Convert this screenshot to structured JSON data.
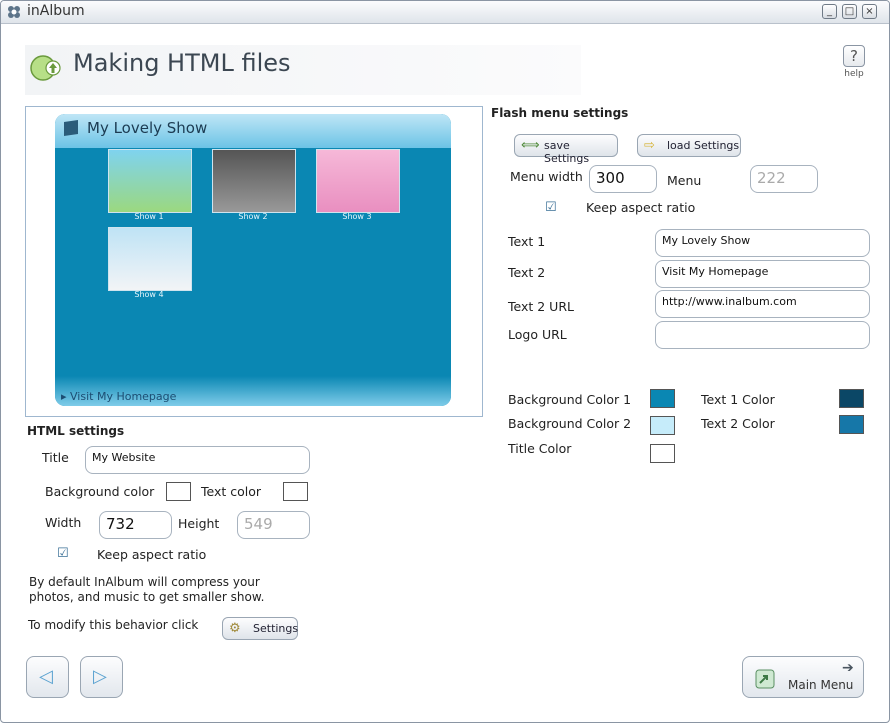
{
  "window": {
    "title": "inAlbum",
    "controls": [
      "_",
      "□",
      "×"
    ]
  },
  "header": {
    "title": "Making HTML files",
    "help_label": "help",
    "help_glyph": "?"
  },
  "preview": {
    "show_title": "My Lovely Show",
    "link_text": "▸ Visit My Homepage",
    "thumbs": [
      {
        "label": "Show 1"
      },
      {
        "label": "Show 2"
      },
      {
        "label": "Show 3"
      },
      {
        "label": "Show 4"
      }
    ]
  },
  "html_settings": {
    "heading": "HTML settings",
    "title_label": "Title",
    "title_value": "My Website",
    "bg_color_label": "Background color",
    "text_color_label": "Text color",
    "width_label": "Width",
    "width_value": "732",
    "height_label": "Height",
    "height_value": "549",
    "aspect_label": "Keep aspect ratio",
    "note_line1": "By default InAlbum will compress your",
    "note_line2": "photos, and music to get smaller show.",
    "modify_label": "To modify this behavior click",
    "settings_button": "Settings"
  },
  "flash_settings": {
    "heading": "Flash menu settings",
    "save_button": "save Settings",
    "load_button": "load Settings",
    "menu_width_label": "Menu width",
    "menu_width_value": "300",
    "menu_label": "Menu",
    "menu_value": "222",
    "aspect_label": "Keep aspect ratio",
    "text1_label": "Text 1",
    "text1_value": "My Lovely Show",
    "text2_label": "Text 2",
    "text2_value": "Visit My Homepage",
    "text2url_label": "Text 2 URL",
    "text2url_value": "http://www.inalbum.com",
    "logourl_label": "Logo URL",
    "logourl_value": "",
    "bg1_label": "Background Color 1",
    "bg2_label": "Background Color 2",
    "title_color_label": "Title Color",
    "text1_color_label": "Text 1 Color",
    "text2_color_label": "Text 2 Color"
  },
  "colors": {
    "bg1": "#0a87b3",
    "bg2": "#c6ecfa",
    "title": "#ffffff",
    "text1": "#0b4766",
    "text2": "#1677a8",
    "html_bg": "#ffffff",
    "html_text": "#ffffff"
  },
  "footer": {
    "main_menu": "Main Menu",
    "back_icon": "back-arrow-icon",
    "forward_icon": "forward-arrow-icon"
  }
}
